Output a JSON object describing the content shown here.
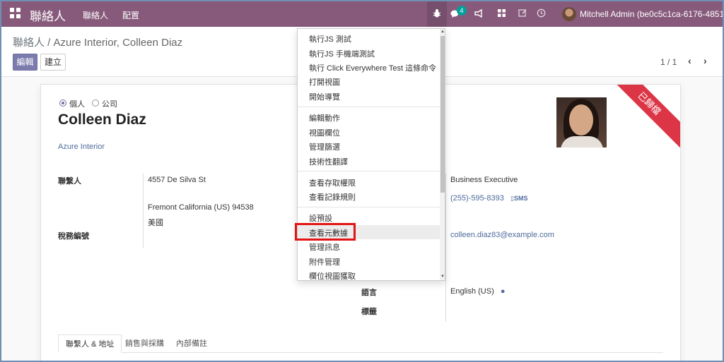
{
  "navbar": {
    "app_title": "聯絡人",
    "menus": [
      "聯絡人",
      "配置"
    ],
    "message_count": "4",
    "user": "Mitchell Admin (be0c5c1ca-6176-4851-...",
    "icons": [
      "apps-grid-icon",
      "bug-icon",
      "chat-icon",
      "megaphone-icon",
      "grid-icon",
      "edit-icon",
      "clock-icon"
    ]
  },
  "breadcrumb": {
    "parent": "聯絡人",
    "separator": " / ",
    "current": "Azure Interior, Colleen Diaz"
  },
  "buttons": {
    "edit": "編輯",
    "create": "建立"
  },
  "pager": {
    "value": "1 / 1"
  },
  "form": {
    "company_type": {
      "person": "個人",
      "company": "公司",
      "selected": "個人"
    },
    "name": "Colleen Diaz",
    "company": "Azure Interior",
    "ribbon": "已歸檔",
    "labels": {
      "address": "聯繫人",
      "vat": "稅務編號",
      "language": "語言",
      "tags": "標籤"
    },
    "address_line1": "4557 De Silva St",
    "address_city": "Fremont  California (US)  94538",
    "address_country": "美國",
    "job_position": "Business Executive",
    "phone": "(255)-595-8393",
    "sms": "SMS",
    "email": "colleen.diaz83@example.com",
    "language": "English (US)"
  },
  "tabs": [
    "聯繫人 & 地址",
    "銷售與採購",
    "內部備註"
  ],
  "debug_menu": {
    "items": [
      "執行JS 測試",
      "執行JS 手機端測試",
      "執行 Click Everywhere Test 這條命令",
      "打開視圖",
      "開始導覽",
      "編輯動作",
      "視圖欄位",
      "管理篩選",
      "技術性翻譯",
      "查看存取權限",
      "查看記錄規則",
      "設預設",
      "查看元數據",
      "管理訊息",
      "附件管理",
      "欄位視圖獲取"
    ],
    "highlighted": "查看元數據"
  }
}
